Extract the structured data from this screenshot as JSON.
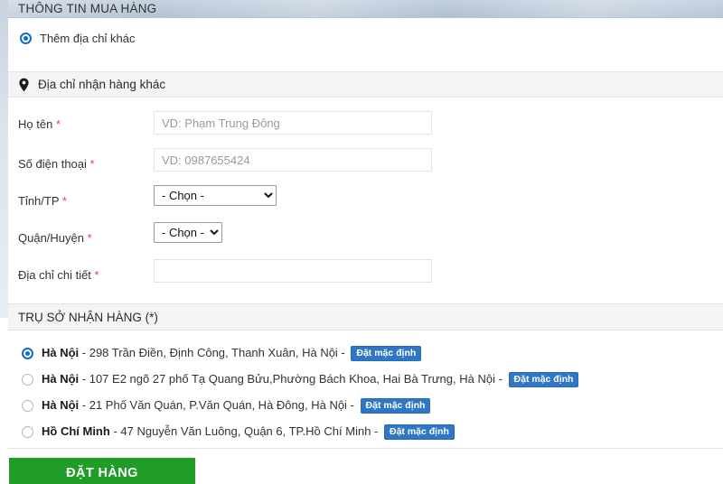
{
  "page": {
    "header_title": "THÔNG TIN MUA HÀNG"
  },
  "address_choice": {
    "option_label": "Thêm địa chỉ khác",
    "selected": true
  },
  "other_address_section": {
    "icon": "map-pin-icon",
    "title": "Địa chỉ nhận hàng khác",
    "fields": [
      {
        "label": "Họ tên",
        "required_mark": "*",
        "type": "text",
        "value": "",
        "placeholder": "VD: Phạm Trung Đông"
      },
      {
        "label": "Số điện thoại",
        "required_mark": "*",
        "type": "text",
        "value": "",
        "placeholder": "VD: 0987655424"
      },
      {
        "label": "Tỉnh/TP",
        "required_mark": "*",
        "type": "select",
        "value": "- Chọn -",
        "options": [
          "- Chọn -"
        ]
      },
      {
        "label": "Quận/Huyện",
        "required_mark": "*",
        "type": "select",
        "value": "- Chọn -",
        "options": [
          "- Chọn -"
        ]
      },
      {
        "label": "Địa chỉ chi tiết",
        "required_mark": "*",
        "type": "text",
        "value": "",
        "placeholder": ""
      }
    ]
  },
  "pickup_section": {
    "title": "TRỤ SỞ NHẬN HÀNG (*)",
    "badge_label": "Đặt mặc định",
    "options": [
      {
        "city": "Hà Nội",
        "address": " - 298 Trần Điền, Định Công, Thanh Xuân, Hà Nội - ",
        "selected": true
      },
      {
        "city": "Hà Nội",
        "address": " - 107 E2 ngõ 27 phố Tạ Quang Bửu,Phường Bách Khoa, Hai Bà Trưng, Hà Nội - ",
        "selected": false
      },
      {
        "city": "Hà Nội",
        "address": " - 21 Phố Văn Quán, P.Văn Quán, Hà Đông, Hà Nội - ",
        "selected": false
      },
      {
        "city": "Hồ Chí Minh",
        "address": " - 47 Nguyễn Văn Luông, Quận 6, TP.Hồ Chí Minh - ",
        "selected": false
      }
    ]
  },
  "footer": {
    "order_button_label": "ĐẶT HÀNG"
  },
  "colors": {
    "accent_blue": "#0c6ed1",
    "badge_blue": "#2f77c4",
    "order_green": "#1f9d27",
    "required_red": "#e8453c"
  }
}
